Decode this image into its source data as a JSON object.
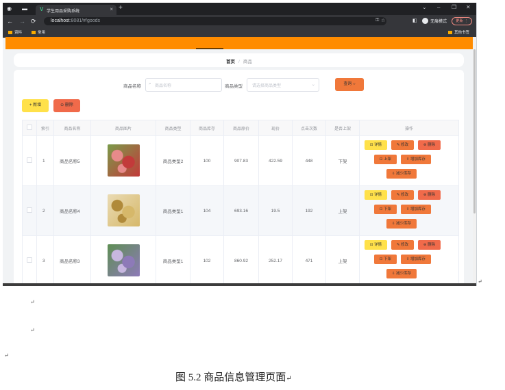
{
  "browser": {
    "tab_title": "学生用品采购系统",
    "tab_close": "×",
    "new_tab": "+",
    "url_host": "localhost",
    "url_rest": ":8081/#/goods",
    "profile_label": "无痕模式",
    "update_label": "更新 ⋮",
    "bookmarks": [
      "资料",
      "常用"
    ],
    "other_bookmarks": "其他书签"
  },
  "breadcrumb": {
    "home": "首页",
    "separator": "/",
    "current": "商品"
  },
  "search": {
    "name_label": "商品名称",
    "name_placeholder": "商品名称",
    "type_label": "商品类型",
    "type_placeholder": "请选择商品类型",
    "search_button": "查询 ○"
  },
  "toolbar": {
    "add_label": "+ 新增",
    "delete_label": "⊖ 删除"
  },
  "table": {
    "headers": [
      "索引",
      "商品名称",
      "商品图片",
      "商品类型",
      "商品库存",
      "商品原价",
      "现价",
      "点击次数",
      "是否上架",
      "操作"
    ],
    "rows": [
      {
        "index": "1",
        "name": "商品名称5",
        "type": "商品类型2",
        "stock": "100",
        "original_price": "907.83",
        "price": "422.59",
        "clicks": "448",
        "on_sale": "下架",
        "toggle_label": "⊡ 上架",
        "image_colors": [
          "#c23a3a",
          "#e78a8a",
          "#7a9b4a"
        ]
      },
      {
        "index": "2",
        "name": "商品名称4",
        "type": "商品类型1",
        "stock": "104",
        "original_price": "693.16",
        "price": "19.5",
        "clicks": "192",
        "on_sale": "上架",
        "toggle_label": "⊡ 下架",
        "image_colors": [
          "#d6b86a",
          "#b08a3a",
          "#eadbb4"
        ]
      },
      {
        "index": "3",
        "name": "商品名称3",
        "type": "商品类型1",
        "stock": "102",
        "original_price": "860.92",
        "price": "252.17",
        "clicks": "471",
        "on_sale": "上架",
        "toggle_label": "⊡ 下架",
        "image_colors": [
          "#8d7ab8",
          "#c7b7e0",
          "#5e8f54"
        ]
      }
    ],
    "actions": {
      "detail": "⊡ 详情",
      "edit": "✎ 修改",
      "delete": "⊖ 删除",
      "add_stock": "⇪ 增加库存",
      "reduce_stock": "⇩ 减少库存"
    }
  },
  "doc": {
    "caption": "图 5.2 商品信息管理页面",
    "para_marks": [
      "↵",
      "↵",
      "↵",
      "↵",
      "↵"
    ]
  },
  "colors": {
    "nav": "#ff8c00",
    "yellow_btn": "#ffe14a",
    "orange_btn": "#f0783a",
    "red_btn": "#f06a4a"
  }
}
